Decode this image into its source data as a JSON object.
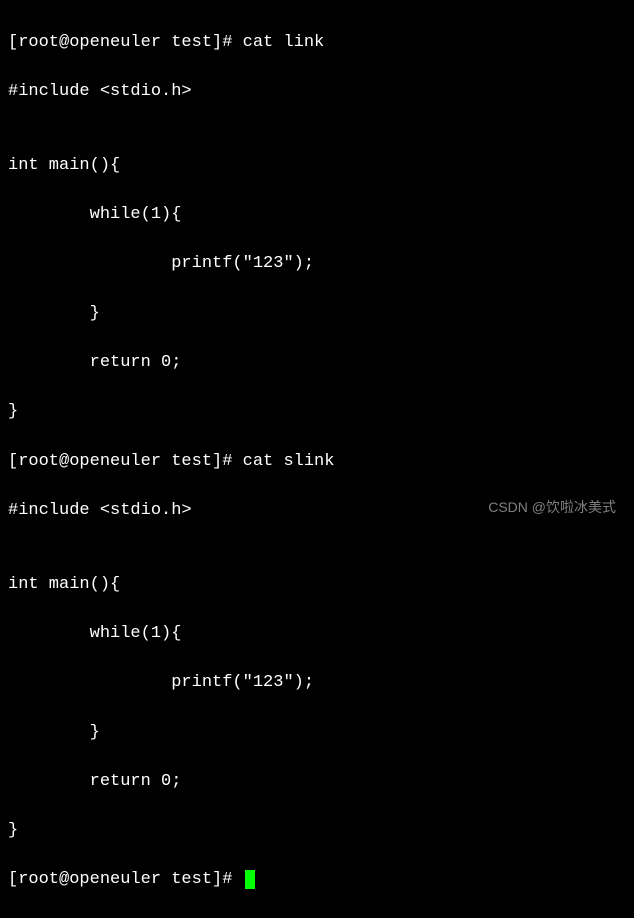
{
  "terminal": {
    "lines": [
      "[root@openeuler test]# cat link",
      "#include <stdio.h>",
      "",
      "int main(){",
      "        while(1){",
      "                printf(\"123\");",
      "        }",
      "        return 0;",
      "}",
      "[root@openeuler test]# cat slink",
      "#include <stdio.h>",
      "",
      "int main(){",
      "        while(1){",
      "                printf(\"123\");",
      "        }",
      "        return 0;",
      "}",
      "[root@openeuler test]# "
    ]
  },
  "watermark": "CSDN @饮啦冰美式"
}
